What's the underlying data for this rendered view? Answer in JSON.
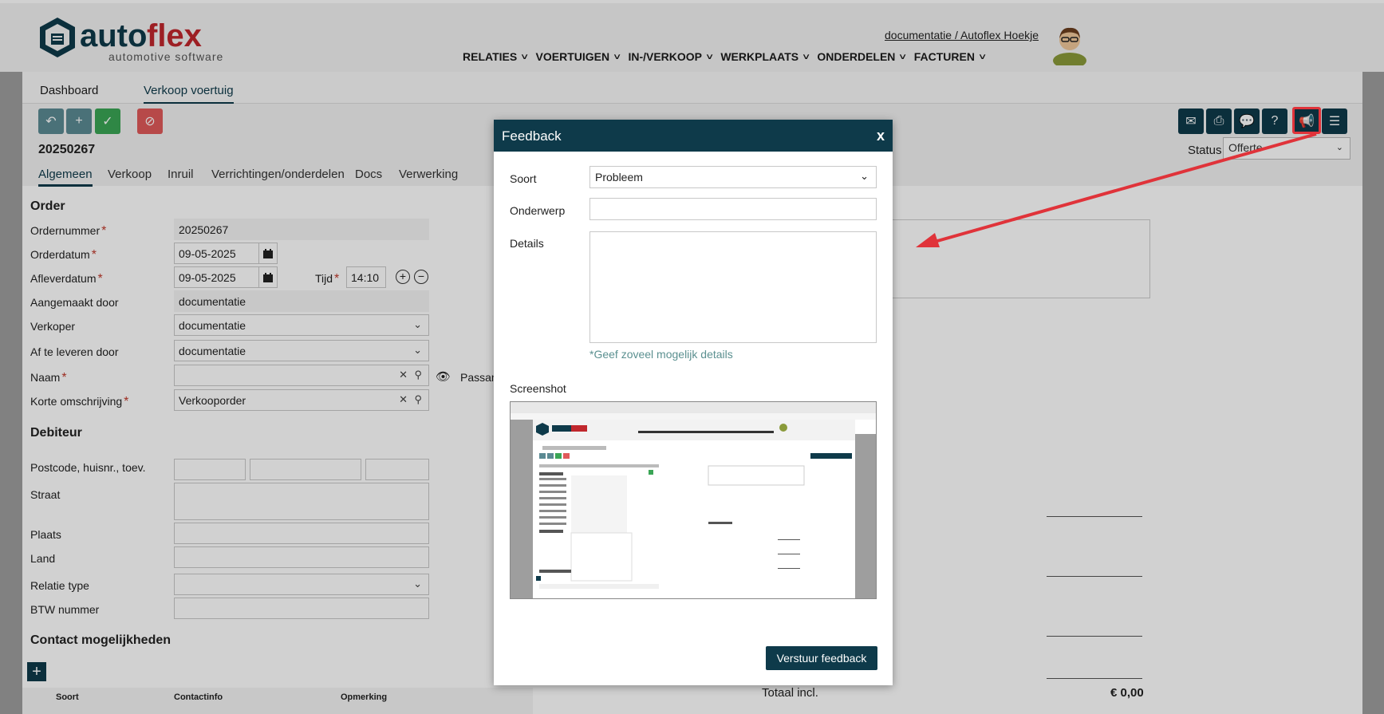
{
  "header": {
    "logo_main": "autoflex",
    "logo_sub": "automotive software",
    "user_link": "documentatie / Autoflex Hoekje",
    "nav": [
      "RELATIES",
      "VOERTUIGEN",
      "IN-/VERKOOP",
      "WERKPLAATS",
      "ONDERDELEN",
      "FACTUREN"
    ]
  },
  "tabs": [
    "Dashboard",
    "Verkoop voertuig"
  ],
  "order": {
    "number_title": "20250267",
    "status_label": "Status",
    "status_value": "Offerte",
    "subtabs": [
      "Algemeen",
      "Verkoop",
      "Inruil",
      "Verrichtingen/onderdelen",
      "Docs",
      "Verwerking"
    ]
  },
  "form": {
    "section_order": "Order",
    "ordernummer_label": "Ordernummer",
    "ordernummer_value": "20250267",
    "orderdatum_label": "Orderdatum",
    "orderdatum_value": "09-05-2025",
    "afleverdatum_label": "Afleverdatum",
    "afleverdatum_value": "09-05-2025",
    "tijd_label": "Tijd",
    "tijd_value": "14:10",
    "aangemaakt_label": "Aangemaakt door",
    "aangemaakt_value": "documentatie",
    "verkoper_label": "Verkoper",
    "verkoper_value": "documentatie",
    "afleveren_label": "Af te leveren door",
    "afleveren_value": "documentatie",
    "naam_label": "Naam",
    "passant_label": "Passan",
    "korte_label": "Korte omschrijving",
    "korte_value": "Verkooporder",
    "section_debiteur": "Debiteur",
    "postcode_label": "Postcode, huisnr., toev.",
    "straat_label": "Straat",
    "plaats_label": "Plaats",
    "land_label": "Land",
    "relatie_label": "Relatie type",
    "btw_label": "BTW nummer",
    "section_contact": "Contact mogelijkheden",
    "contact_cols": [
      "Soort",
      "Contactinfo",
      "Opmerking"
    ]
  },
  "summary": {
    "totaal_label": "Totaal incl.",
    "totaal_value": "€ 0,00"
  },
  "feedback": {
    "title": "Feedback",
    "close": "x",
    "soort_label": "Soort",
    "soort_value": "Probleem",
    "onderwerp_label": "Onderwerp",
    "details_label": "Details",
    "hint": "*Geef zoveel mogelijk details",
    "screenshot_label": "Screenshot",
    "send_button": "Verstuur feedback"
  },
  "colors": {
    "brand_dark": "#0e3a4a",
    "logo_red": "#c0272d",
    "accent_green": "#3aa555",
    "accent_red": "#e05a5a",
    "arrow_red": "#e0333a"
  }
}
